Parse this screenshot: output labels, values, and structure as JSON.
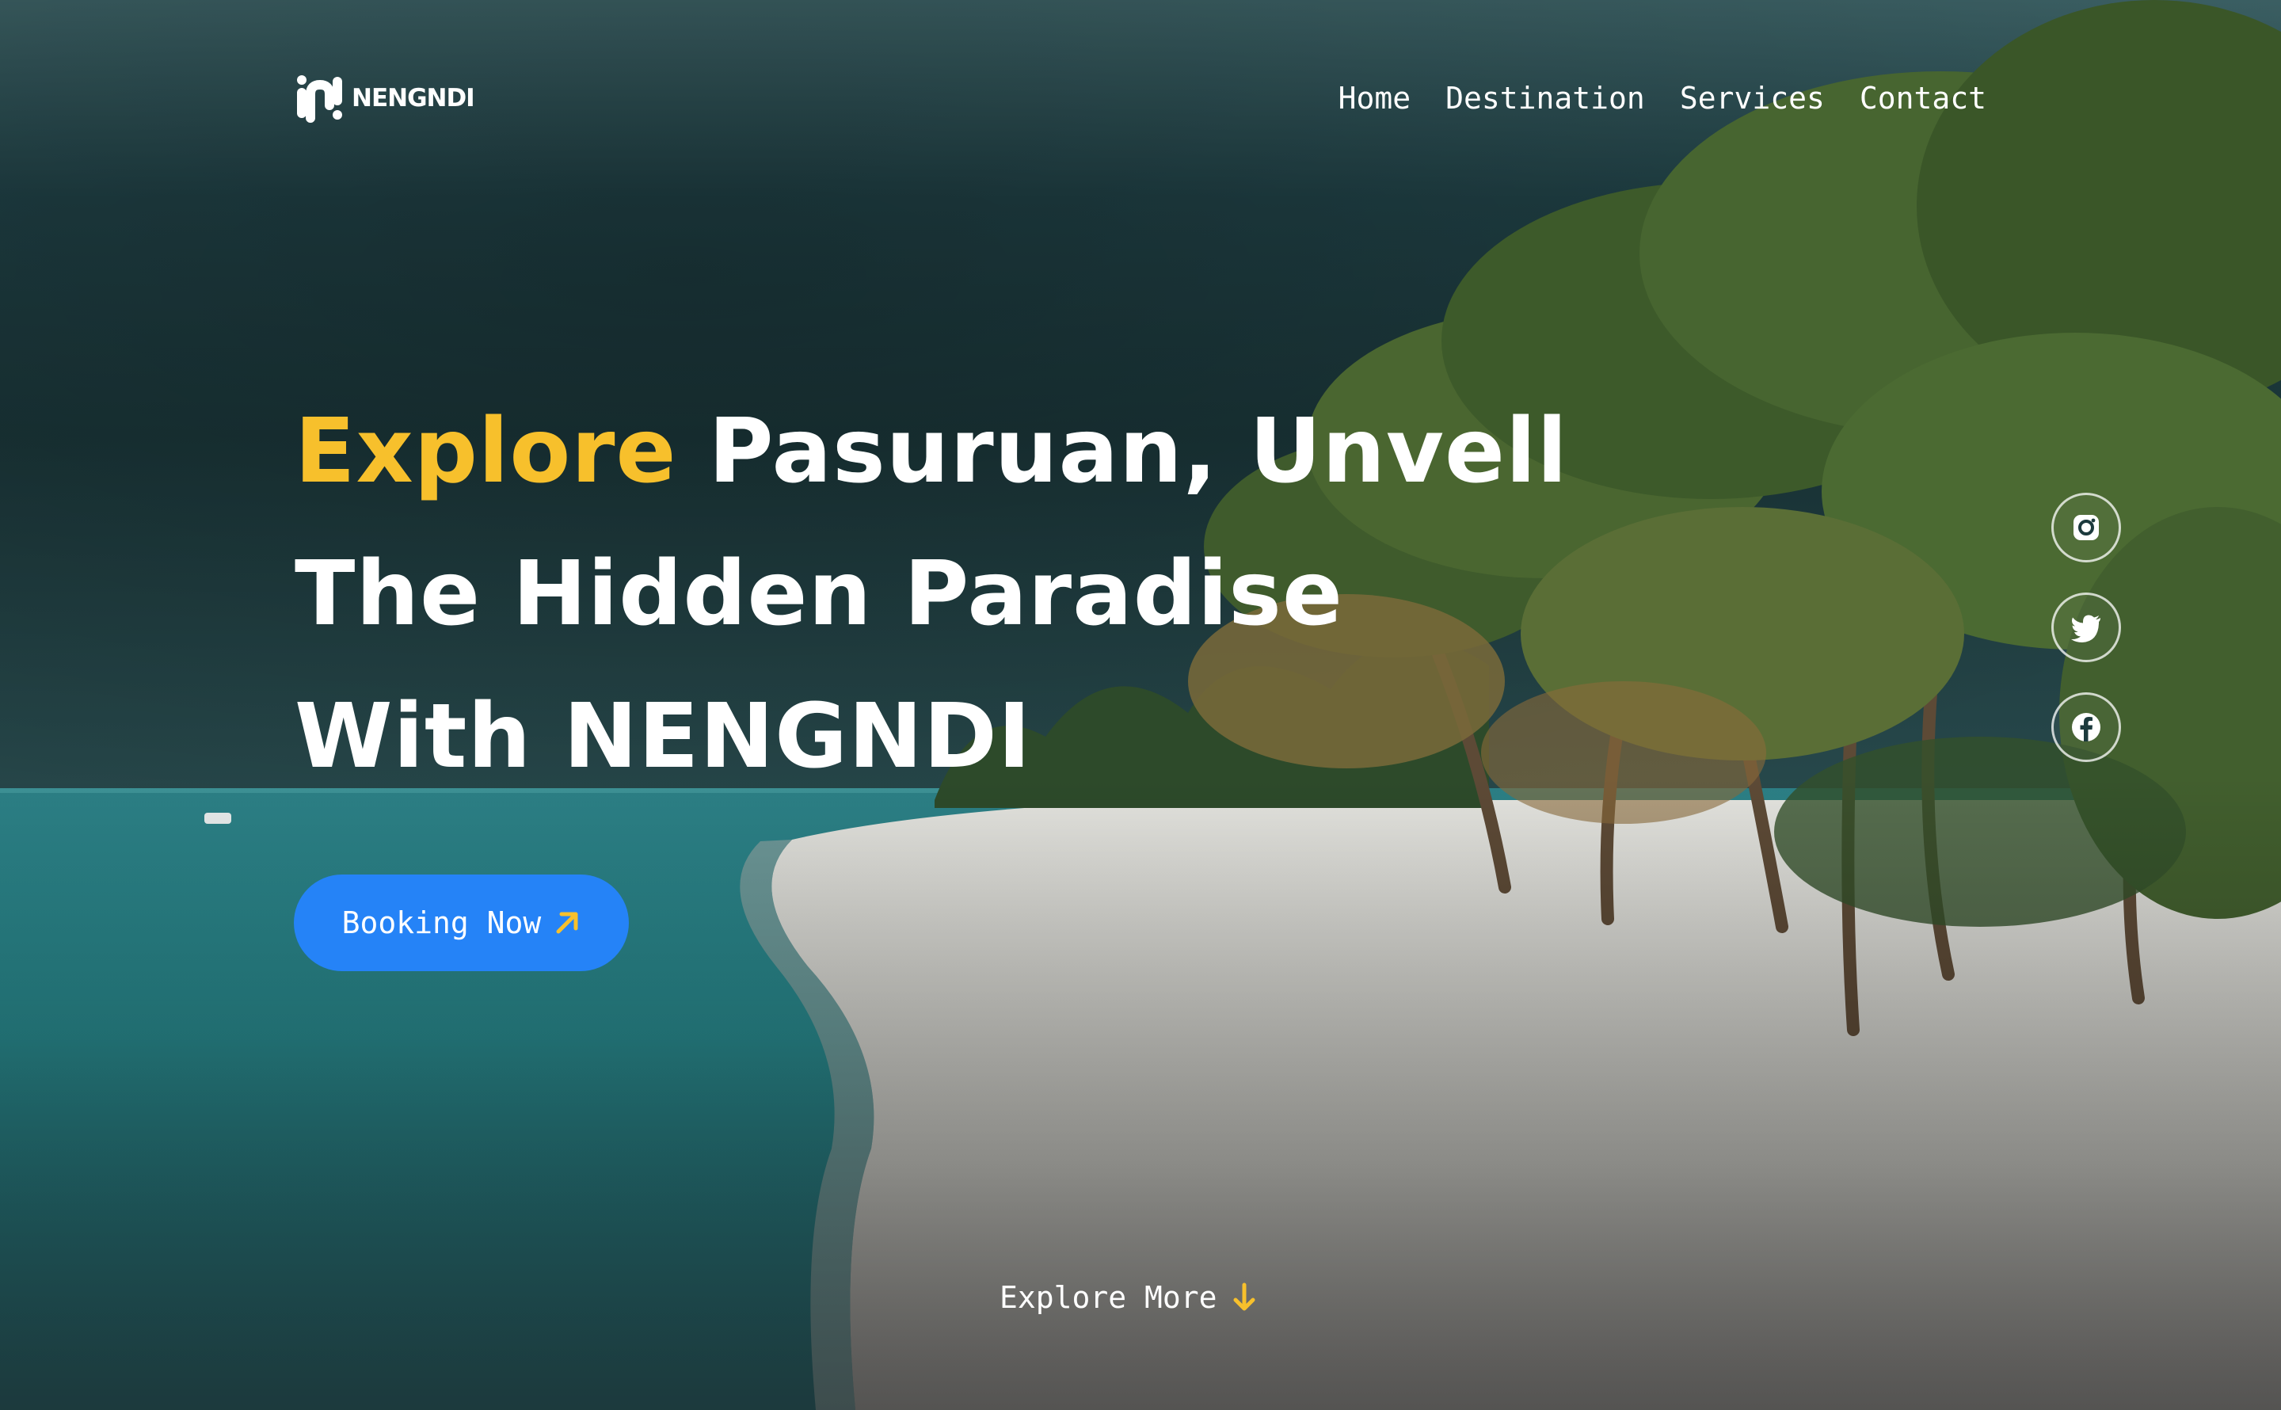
{
  "brand": {
    "name": "NENGNDI",
    "logo_icon": "nengndi-logo-icon"
  },
  "nav": {
    "items": [
      {
        "label": "Home"
      },
      {
        "label": "Destination"
      },
      {
        "label": "Services"
      },
      {
        "label": "Contact"
      }
    ]
  },
  "hero": {
    "headline": {
      "accent": "Explore",
      "line1_rest": " Pasuruan, Unvell",
      "line2": "The Hidden Paradise",
      "line3": "With NENGNDI"
    },
    "cta_label": "Booking Now",
    "cta_icon": "arrow-up-right-icon",
    "explore_more_label": "Explore More",
    "explore_more_icon": "arrow-down-icon",
    "background": "tropical beach with palm trees under stormy sky"
  },
  "social": [
    {
      "name": "instagram",
      "icon": "instagram-icon"
    },
    {
      "name": "twitter",
      "icon": "twitter-icon"
    },
    {
      "name": "facebook",
      "icon": "facebook-icon"
    }
  ],
  "colors": {
    "accent_yellow": "#f7c02c",
    "button_blue": "#2583f7",
    "text_white": "#ffffff",
    "sky_dark": "#15363a",
    "sea_teal": "#2f8a8c",
    "sand": "#dcdcd6",
    "palm_green": "#3d5a2a"
  }
}
